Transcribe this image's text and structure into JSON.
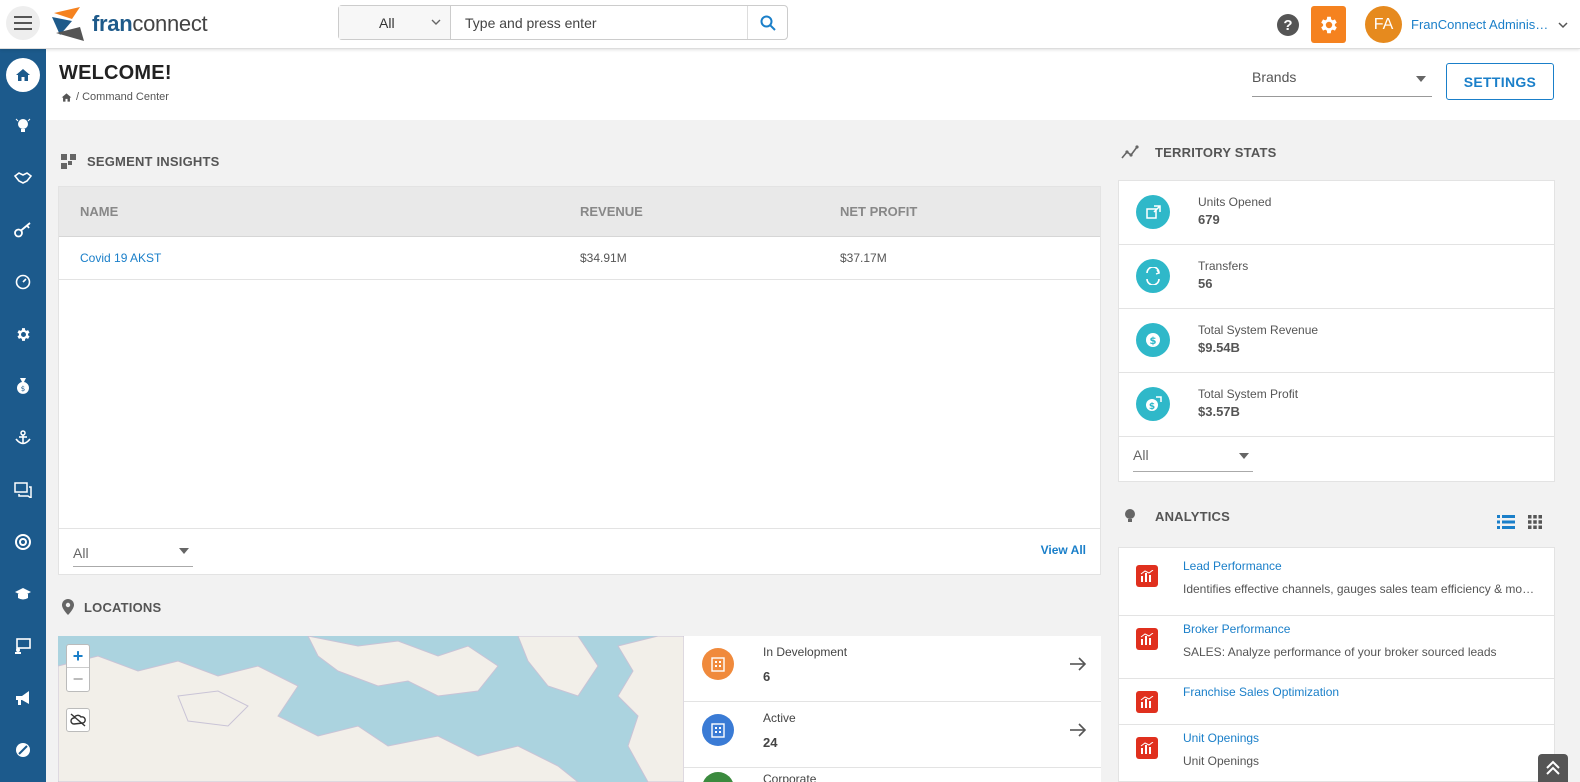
{
  "header": {
    "logo_fran": "fran",
    "logo_connect": "connect",
    "search_scope": "All",
    "search_placeholder": "Type and press enter",
    "avatar_initials": "FA",
    "user_name": "FranConnect Administr..."
  },
  "page": {
    "title": "WELCOME!",
    "breadcrumb": "/ Command Center",
    "brands_label": "Brands",
    "settings_label": "SETTINGS"
  },
  "segment_insights": {
    "title": "SEGMENT INSIGHTS",
    "columns": [
      "NAME",
      "REVENUE",
      "NET PROFIT"
    ],
    "rows": [
      {
        "name": "Covid 19 AKST",
        "revenue": "$34.91M",
        "net_profit": "$37.17M"
      }
    ],
    "filter_value": "All",
    "view_all": "View All"
  },
  "locations": {
    "title": "LOCATIONS",
    "zoom_in": "+",
    "zoom_out": "−",
    "items": [
      {
        "label": "In Development",
        "count": "6",
        "color": "#f08a3c"
      },
      {
        "label": "Active",
        "count": "24",
        "color": "#3a7bd5"
      },
      {
        "label": "Corporate",
        "count": "",
        "color": "#3b8a3e"
      }
    ]
  },
  "territory_stats": {
    "title": "TERRITORY STATS",
    "items": [
      {
        "label": "Units Opened",
        "value": "679"
      },
      {
        "label": "Transfers",
        "value": "56"
      },
      {
        "label": "Total System Revenue",
        "value": "$9.54B"
      },
      {
        "label": "Total System Profit",
        "value": "$3.57B"
      }
    ],
    "filter_value": "All"
  },
  "analytics": {
    "title": "ANALYTICS",
    "items": [
      {
        "title": "Lead Performance",
        "desc": "Identifies effective channels, gauges sales team efficiency & monitors lead conversion"
      },
      {
        "title": "Broker Performance",
        "desc": "SALES: Analyze performance of your broker sourced leads"
      },
      {
        "title": "Franchise Sales Optimization",
        "desc": ""
      },
      {
        "title": "Unit Openings",
        "desc": "Unit Openings"
      }
    ]
  },
  "colors": {
    "sidebar": "#1c5a8c",
    "accent": "#1a7fc9",
    "orange": "#f5821f",
    "teal": "#2fb8c9",
    "analytics_red": "#e0301e"
  }
}
